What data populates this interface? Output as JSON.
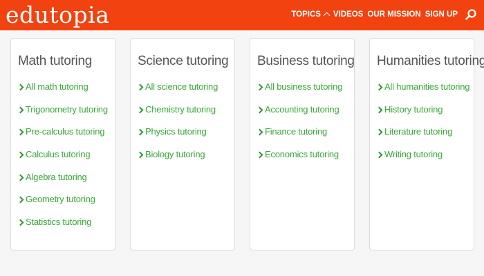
{
  "header": {
    "logo": "edutopia",
    "nav": [
      {
        "label": "TOPICS",
        "has_caret": true
      },
      {
        "label": "VIDEOS"
      },
      {
        "label": "OUR MISSION"
      },
      {
        "label": "SIGN UP"
      }
    ],
    "search_icon": "search-icon"
  },
  "colors": {
    "header_bg": "#f2420f",
    "link_green": "#3aa63a",
    "title_gray": "#555555"
  },
  "cards": [
    {
      "title": "Math tutoring",
      "links": [
        "All math tutoring",
        "Trigonometry tutoring",
        "Pre-calculus tutoring",
        "Calculus tutoring",
        "Algebra tutoring",
        "Geometry tutoring",
        "Statistics tutoring"
      ]
    },
    {
      "title": "Science tutoring",
      "links": [
        "All science tutoring",
        "Chemistry tutoring",
        "Physics tutoring",
        "Biology tutoring"
      ]
    },
    {
      "title": "Business tutoring",
      "links": [
        "All business tutoring",
        "Accounting tutoring",
        "Finance tutoring",
        "Economics tutoring"
      ]
    },
    {
      "title": "Humanities tutoring",
      "links": [
        "All humanities tutoring",
        "History tutoring",
        "Literature tutoring",
        "Writing tutoring"
      ]
    }
  ]
}
